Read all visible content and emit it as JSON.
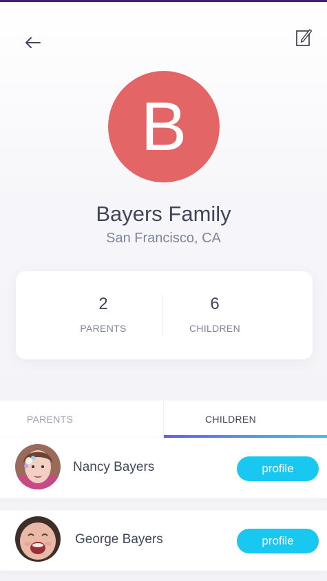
{
  "header": {
    "back_icon": "arrow-left-icon",
    "edit_icon": "edit-icon"
  },
  "family": {
    "initial": "B",
    "avatar_color": "#e46566",
    "name": "Bayers Family",
    "location": "San Francisco, CA"
  },
  "stats": {
    "parents_count": "2",
    "parents_label": "PARENTS",
    "children_count": "6",
    "children_label": "CHILDREN"
  },
  "tabs": [
    {
      "label": "PARENTS",
      "active": false
    },
    {
      "label": "CHILDREN",
      "active": true
    }
  ],
  "children": [
    {
      "name": "Nancy Bayers",
      "button_label": "profile"
    },
    {
      "name": "George Bayers",
      "button_label": "profile"
    }
  ],
  "colors": {
    "accent": "#18c8f0",
    "text": "#3f4659",
    "muted": "#7d8597"
  }
}
